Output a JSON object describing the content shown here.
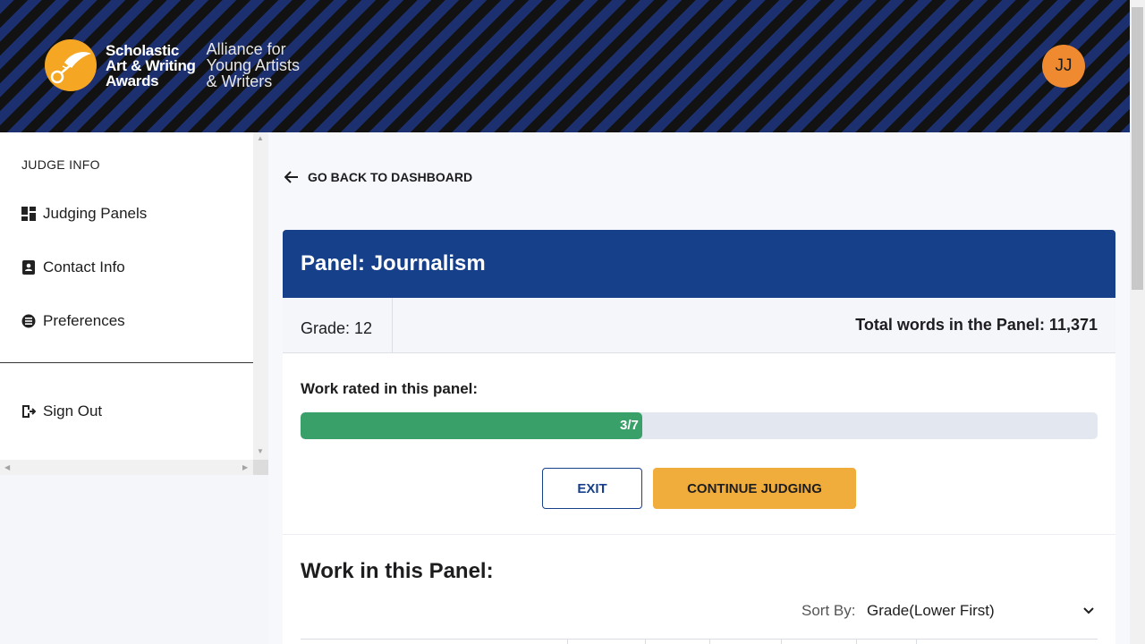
{
  "header": {
    "logo_lines": [
      "Scholastic",
      "Art & Writing",
      "Awards"
    ],
    "sub_lines": [
      "Alliance for",
      "Young Artists",
      "& Writers"
    ],
    "avatar_initials": "JJ",
    "colors": {
      "stripe_blue": "#1c2f6e",
      "stripe_dark": "#121212",
      "logo_orange": "#f5a623",
      "avatar": "#f08a30"
    }
  },
  "sidebar": {
    "section_title": "JUDGE INFO",
    "items": [
      {
        "label": "Judging Panels",
        "icon": "dashboard-icon"
      },
      {
        "label": "Contact Info",
        "icon": "contact-book-icon"
      },
      {
        "label": "Preferences",
        "icon": "preferences-icon"
      }
    ],
    "sign_out": {
      "label": "Sign Out",
      "icon": "sign-out-icon"
    }
  },
  "main": {
    "back_link": "GO BACK TO DASHBOARD",
    "panel": {
      "title": "Panel: Journalism",
      "grade": "Grade: 12",
      "total_words": "Total words in the Panel: 11,371",
      "rated_label": "Work rated in this panel:",
      "progress_text": "3/7",
      "progress_fraction": 0.4286,
      "exit_label": "EXIT",
      "continue_label": "CONTINUE JUDGING",
      "work_title": "Work in this Panel:",
      "sort_label": "Sort By:",
      "sort_value": "Grade(Lower First)"
    },
    "colors": {
      "panel_header": "#17408b",
      "progress_fill": "#3aa069",
      "continue_button": "#f0ad3c"
    }
  }
}
